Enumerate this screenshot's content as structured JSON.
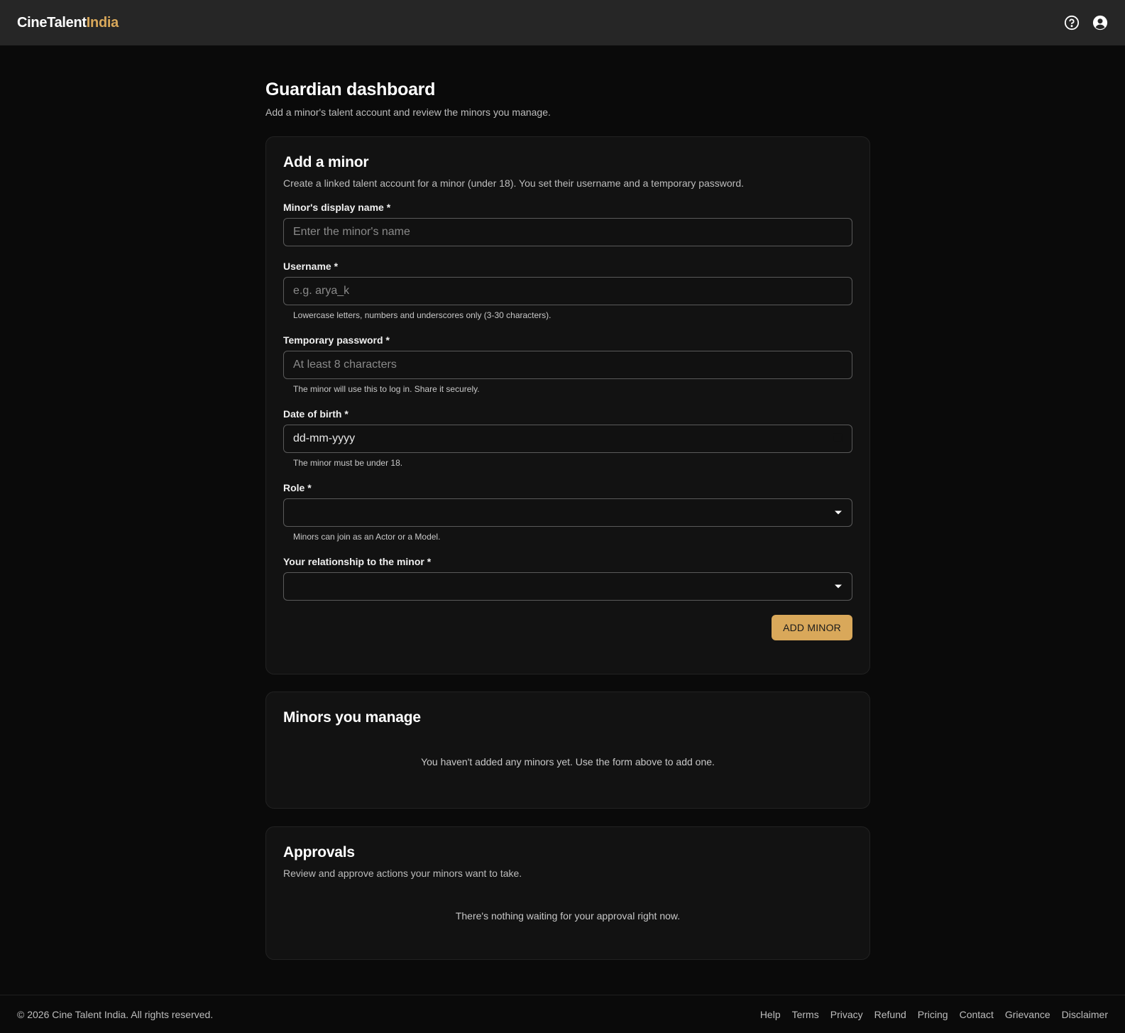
{
  "header": {
    "logo_main": "CineTalent",
    "logo_accent": "India"
  },
  "page": {
    "title": "Guardian dashboard",
    "subtitle": "Add a minor's talent account and review the minors you manage."
  },
  "add_minor": {
    "title": "Add a minor",
    "description": "Create a linked talent account for a minor (under 18). You set their username and a temporary password.",
    "fields": {
      "display_name": {
        "label": "Minor's display name *",
        "placeholder": "Enter the minor's name"
      },
      "username": {
        "label": "Username *",
        "placeholder": "e.g. arya_k",
        "hint": "Lowercase letters, numbers and underscores only (3-30 characters)."
      },
      "password": {
        "label": "Temporary password *",
        "placeholder": "At least 8 characters",
        "hint": "The minor will use this to log in. Share it securely."
      },
      "dob": {
        "label": "Date of birth *",
        "value": "dd-mm-yyyy",
        "hint": "The minor must be under 18."
      },
      "role": {
        "label": "Role *",
        "value": "",
        "hint": "Minors can join as an Actor or a Model."
      },
      "relationship": {
        "label": "Your relationship to the minor *",
        "value": ""
      }
    },
    "submit_label": "ADD MINOR"
  },
  "minors": {
    "title": "Minors you manage",
    "empty": "You haven't added any minors yet. Use the form above to add one."
  },
  "approvals": {
    "title": "Approvals",
    "description": "Review and approve actions your minors want to take.",
    "empty": "There's nothing waiting for your approval right now."
  },
  "footer": {
    "copyright": "© 2026 Cine Talent India. All rights reserved.",
    "links": [
      "Help",
      "Terms",
      "Privacy",
      "Refund",
      "Pricing",
      "Contact",
      "Grievance",
      "Disclaimer"
    ]
  }
}
